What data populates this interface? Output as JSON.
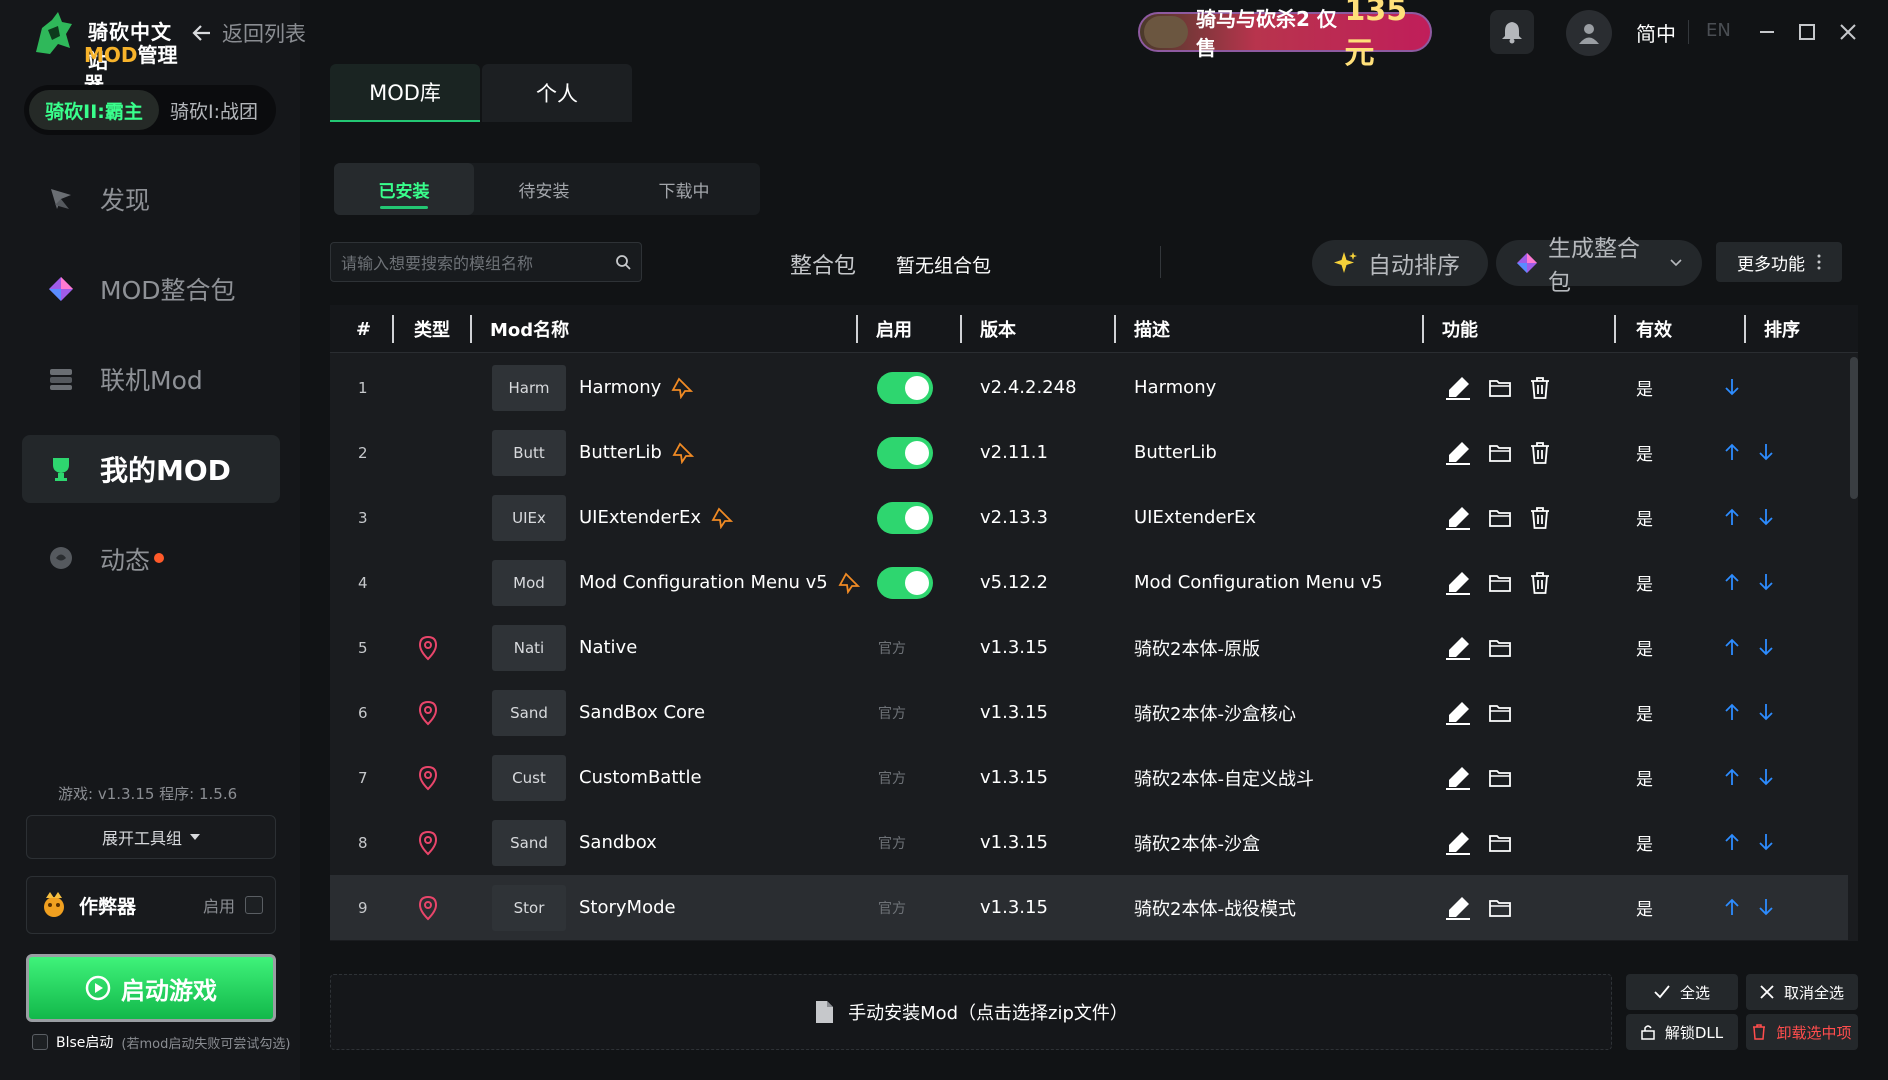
{
  "app": {
    "logo_line1": "骑砍中文站",
    "logo_line2_mod": "MOD",
    "logo_line2_rest": "管理器",
    "back_label": "返回列表"
  },
  "game_switch": {
    "active": "骑砍II:霸主",
    "other": "骑砍I:战团"
  },
  "nav": [
    {
      "label": "发现",
      "icon": "compass-icon"
    },
    {
      "label": "MOD整合包",
      "icon": "diamond-icon"
    },
    {
      "label": "联机Mod",
      "icon": "server-icon"
    },
    {
      "label": "我的MOD",
      "icon": "trophy-icon"
    },
    {
      "label": "动态",
      "icon": "chat-bubble-icon"
    }
  ],
  "version_info": "游戏: v1.3.15   程序: 1.5.6",
  "tools_label": "展开工具组",
  "cheat": {
    "label": "作弊器",
    "enable": "启用"
  },
  "start_label": "启动游戏",
  "bise": {
    "label": "Blse启动",
    "hint": "(若mod启动失败可尝试勾选)"
  },
  "banner": {
    "text": "骑马与砍杀2 仅售",
    "price": "135元"
  },
  "lang": {
    "zh": "简中",
    "en": "EN"
  },
  "lib_tabs": [
    "MOD库",
    "个人"
  ],
  "sub_tabs": [
    "已安装",
    "待安装",
    "下载中"
  ],
  "search": {
    "placeholder": "请输入想要搜索的模组名称"
  },
  "pack": {
    "label": "整合包",
    "value": "暂无组合包"
  },
  "buttons": {
    "auto_sort": "自动排序",
    "gen_pack": "生成整合包",
    "more": "更多功能"
  },
  "table": {
    "headers": {
      "num": "#",
      "type": "类型",
      "name": "Mod名称",
      "enabled": "启用",
      "version": "版本",
      "desc": "描述",
      "func": "功能",
      "valid": "有效",
      "sort": "排序"
    },
    "rows": [
      {
        "num": "1",
        "thumb": "Harm",
        "name": "Harmony",
        "pinned": true,
        "enabled": true,
        "official": false,
        "tag": "",
        "version": "v2.4.2.248",
        "desc": "Harmony",
        "valid": "是",
        "up": false,
        "down": true,
        "delete": true,
        "selected": false
      },
      {
        "num": "2",
        "thumb": "Butt",
        "name": "ButterLib",
        "pinned": true,
        "enabled": true,
        "official": false,
        "tag": "",
        "version": "v2.11.1",
        "desc": "ButterLib",
        "valid": "是",
        "up": true,
        "down": true,
        "delete": true,
        "selected": false
      },
      {
        "num": "3",
        "thumb": "UIEx",
        "name": "UIExtenderEx",
        "pinned": true,
        "enabled": true,
        "official": false,
        "tag": "",
        "version": "v2.13.3",
        "desc": "UIExtenderEx",
        "valid": "是",
        "up": true,
        "down": true,
        "delete": true,
        "selected": false
      },
      {
        "num": "4",
        "thumb": "Mod",
        "name": "Mod Configuration Menu v5",
        "pinned": true,
        "enabled": true,
        "official": false,
        "tag": "",
        "version": "v5.12.2",
        "desc": "Mod Configuration Menu v5",
        "valid": "是",
        "up": true,
        "down": true,
        "delete": true,
        "selected": false
      },
      {
        "num": "5",
        "thumb": "Nati",
        "name": "Native",
        "pinned": false,
        "enabled": false,
        "official": true,
        "tag": "官方",
        "version": "v1.3.15",
        "desc": "骑砍2本体-原版",
        "valid": "是",
        "up": true,
        "down": true,
        "delete": false,
        "selected": false
      },
      {
        "num": "6",
        "thumb": "Sand",
        "name": "SandBox Core",
        "pinned": false,
        "enabled": false,
        "official": true,
        "tag": "官方",
        "version": "v1.3.15",
        "desc": "骑砍2本体-沙盒核心",
        "valid": "是",
        "up": true,
        "down": true,
        "delete": false,
        "selected": false
      },
      {
        "num": "7",
        "thumb": "Cust",
        "name": "CustomBattle",
        "pinned": false,
        "enabled": false,
        "official": true,
        "tag": "官方",
        "version": "v1.3.15",
        "desc": "骑砍2本体-自定义战斗",
        "valid": "是",
        "up": true,
        "down": true,
        "delete": false,
        "selected": false
      },
      {
        "num": "8",
        "thumb": "Sand",
        "name": "Sandbox",
        "pinned": false,
        "enabled": false,
        "official": true,
        "tag": "官方",
        "version": "v1.3.15",
        "desc": "骑砍2本体-沙盒",
        "valid": "是",
        "up": true,
        "down": true,
        "delete": false,
        "selected": false
      },
      {
        "num": "9",
        "thumb": "Stor",
        "name": "StoryMode",
        "pinned": false,
        "enabled": false,
        "official": true,
        "tag": "官方",
        "version": "v1.3.15",
        "desc": "骑砍2本体-战役模式",
        "valid": "是",
        "up": true,
        "down": true,
        "delete": false,
        "selected": true
      }
    ]
  },
  "manual_install": "手动安装Mod（点击选择zip文件）",
  "bottom": {
    "select_all": "全选",
    "deselect_all": "取消全选",
    "unlock_dll": "解锁DLL",
    "uninstall": "卸载选中项"
  },
  "colors": {
    "accent": "#23c773",
    "accent_text": "#39ff8c",
    "danger": "#ff4d4d",
    "arrow": "#2d8cff",
    "pin": "#f08a24",
    "location": "#e8456a"
  }
}
